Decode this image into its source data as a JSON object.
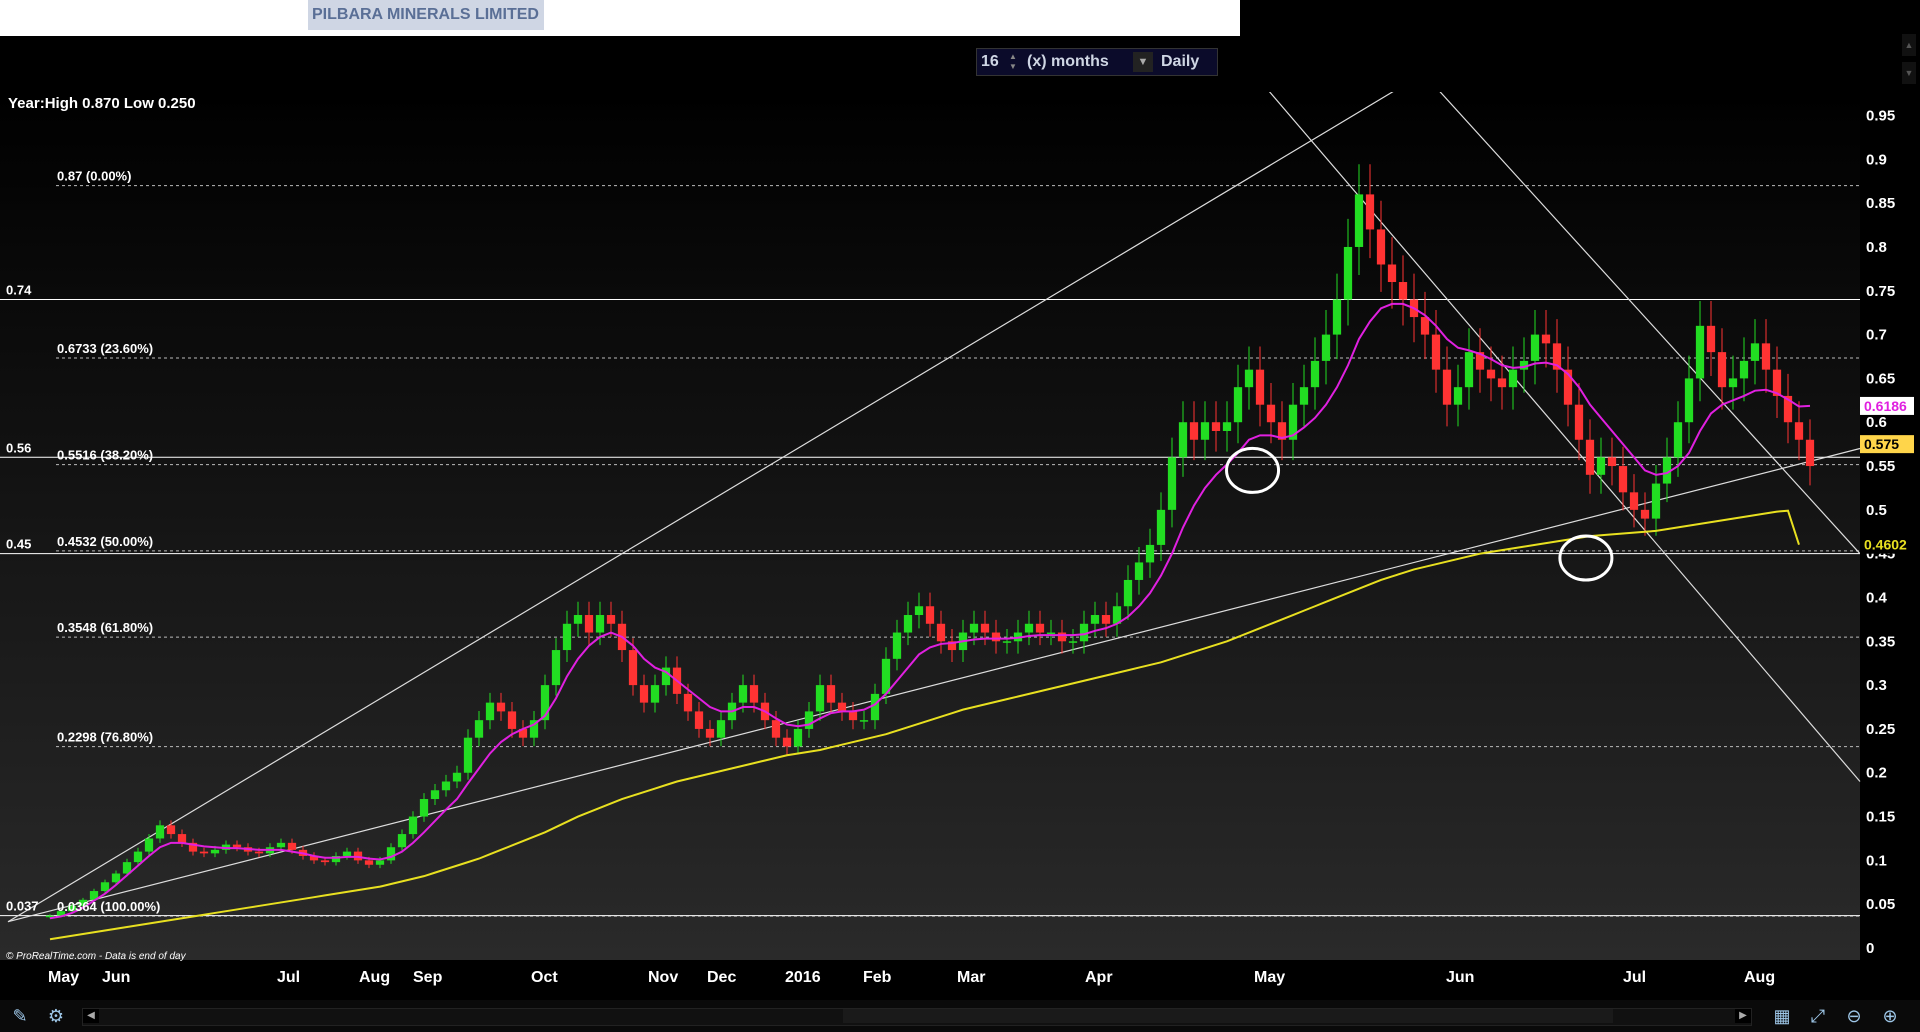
{
  "window": {
    "instrument_title": "PILBARA MINERALS LIMITED"
  },
  "toolbar": {
    "period_value": "16",
    "period_unit": "(x) months",
    "interval": "Daily"
  },
  "icons": {
    "spinner": "spinner-arrows-icon",
    "dropdown": "chevron-down-icon",
    "left": "scroll-left-icon",
    "right": "scroll-right-icon",
    "edit": "edit-chart-icon",
    "tools": "drawing-tools-icon",
    "settings": "chart-settings-icon",
    "zoom_fit": "zoom-fit-icon",
    "zoom_out": "zoom-out-icon",
    "zoom_in": "zoom-in-icon"
  },
  "colors": {
    "up": "#22dd22",
    "down": "#ff3333",
    "ma_short": "#e020e0",
    "ma_long": "#e8e020",
    "grid": "#ffffff",
    "axis_text": "#ffffff"
  },
  "chart_data": {
    "type": "candlestick",
    "title": "",
    "info_text": "Year:High 0.870 Low 0.250",
    "credit_text": "© ProRealTime.com - Data is end of day",
    "x_labels": [
      "May",
      "Jun",
      "Jul",
      "Aug",
      "Sep",
      "Oct",
      "Nov",
      "Dec",
      "2016",
      "Feb",
      "Mar",
      "Apr",
      "May",
      "Jun",
      "Jul",
      "Aug"
    ],
    "y_ticks": [
      "0.95",
      "0.9",
      "0.85",
      "0.8",
      "0.75",
      "0.7",
      "0.65",
      "0.6",
      "0.55",
      "0.5",
      "0.45",
      "0.4",
      "0.35",
      "0.3",
      "0.25",
      "0.2",
      "0.15",
      "0.1",
      "0.05",
      "0"
    ],
    "ylim": [
      0,
      0.97
    ],
    "price_tags": [
      {
        "text": "0.6186",
        "value": 0.6186,
        "bg": "#ffffff",
        "fg": "#e020e0"
      },
      {
        "text": "0.575",
        "value": 0.575,
        "bg": "#ffd54a",
        "fg": "#000000"
      },
      {
        "text": "0.4602",
        "value": 0.4602,
        "bg": "#000000",
        "fg": "#e8e020"
      }
    ],
    "fibonacci_levels": [
      {
        "label": "0.87 (0.00%)",
        "value": 0.87
      },
      {
        "label": "0.6733 (23.60%)",
        "value": 0.6733
      },
      {
        "label": "0.5516 (38.20%)",
        "value": 0.5516
      },
      {
        "label": "0.4532 (50.00%)",
        "value": 0.4532
      },
      {
        "label": "0.3548 (61.80%)",
        "value": 0.3548
      },
      {
        "label": "0.2298 (76.80%)",
        "value": 0.2298
      },
      {
        "label": "0.0364 (100.00%)",
        "value": 0.0364
      }
    ],
    "horizontal_lines": [
      {
        "label": "0.74",
        "value": 0.74
      },
      {
        "label": "0.56",
        "value": 0.56
      },
      {
        "label": "0.45",
        "value": 0.45
      },
      {
        "label": "0.037",
        "value": 0.037
      }
    ],
    "trendlines": [
      {
        "name": "upper-support",
        "from": [
          0.0,
          0.03
        ],
        "to": [
          0.75,
          0.98
        ]
      },
      {
        "name": "lower-support",
        "from": [
          0.0,
          0.03
        ],
        "to": [
          1.0,
          0.57
        ]
      },
      {
        "name": "downtrend-1",
        "from": [
          0.68,
          0.98
        ],
        "to": [
          1.0,
          0.19
        ]
      },
      {
        "name": "downtrend-2",
        "from": [
          0.772,
          0.98
        ],
        "to": [
          1.0,
          0.45
        ]
      }
    ],
    "markers": [
      {
        "name": "circle-support-1",
        "x": 0.672,
        "y": 0.545
      },
      {
        "name": "circle-support-2",
        "x": 0.852,
        "y": 0.445
      }
    ],
    "close_series": [
      0.037,
      0.042,
      0.048,
      0.055,
      0.065,
      0.075,
      0.085,
      0.098,
      0.11,
      0.125,
      0.14,
      0.13,
      0.12,
      0.11,
      0.108,
      0.112,
      0.118,
      0.115,
      0.11,
      0.108,
      0.115,
      0.12,
      0.112,
      0.105,
      0.1,
      0.098,
      0.105,
      0.11,
      0.1,
      0.095,
      0.1,
      0.115,
      0.13,
      0.15,
      0.17,
      0.18,
      0.19,
      0.2,
      0.24,
      0.26,
      0.28,
      0.27,
      0.25,
      0.24,
      0.26,
      0.3,
      0.34,
      0.37,
      0.38,
      0.36,
      0.38,
      0.37,
      0.34,
      0.3,
      0.28,
      0.3,
      0.32,
      0.29,
      0.27,
      0.25,
      0.24,
      0.26,
      0.28,
      0.3,
      0.28,
      0.26,
      0.24,
      0.23,
      0.25,
      0.27,
      0.3,
      0.28,
      0.27,
      0.26,
      0.26,
      0.29,
      0.33,
      0.36,
      0.38,
      0.39,
      0.37,
      0.35,
      0.34,
      0.36,
      0.37,
      0.36,
      0.35,
      0.35,
      0.36,
      0.37,
      0.36,
      0.36,
      0.35,
      0.35,
      0.37,
      0.38,
      0.37,
      0.39,
      0.42,
      0.44,
      0.46,
      0.5,
      0.56,
      0.6,
      0.58,
      0.6,
      0.59,
      0.6,
      0.64,
      0.66,
      0.62,
      0.6,
      0.58,
      0.62,
      0.64,
      0.67,
      0.7,
      0.74,
      0.8,
      0.86,
      0.82,
      0.78,
      0.76,
      0.74,
      0.72,
      0.7,
      0.66,
      0.62,
      0.64,
      0.68,
      0.66,
      0.65,
      0.64,
      0.66,
      0.67,
      0.7,
      0.69,
      0.66,
      0.62,
      0.58,
      0.54,
      0.56,
      0.55,
      0.52,
      0.5,
      0.49,
      0.53,
      0.56,
      0.6,
      0.65,
      0.71,
      0.68,
      0.64,
      0.65,
      0.67,
      0.69,
      0.66,
      0.63,
      0.6,
      0.58,
      0.55
    ],
    "ma_short_series": [
      0.034,
      0.036,
      0.04,
      0.046,
      0.054,
      0.062,
      0.072,
      0.083,
      0.094,
      0.105,
      0.115,
      0.12,
      0.12,
      0.118,
      0.116,
      0.115,
      0.114,
      0.114,
      0.113,
      0.112,
      0.112,
      0.112,
      0.11,
      0.108,
      0.105,
      0.103,
      0.103,
      0.104,
      0.104,
      0.102,
      0.101,
      0.104,
      0.11,
      0.12,
      0.132,
      0.145,
      0.158,
      0.17,
      0.188,
      0.205,
      0.222,
      0.235,
      0.244,
      0.25,
      0.255,
      0.265,
      0.285,
      0.31,
      0.33,
      0.345,
      0.355,
      0.36,
      0.355,
      0.345,
      0.33,
      0.32,
      0.315,
      0.305,
      0.295,
      0.285,
      0.275,
      0.27,
      0.27,
      0.275,
      0.275,
      0.27,
      0.262,
      0.255,
      0.253,
      0.255,
      0.262,
      0.268,
      0.27,
      0.27,
      0.272,
      0.278,
      0.29,
      0.305,
      0.32,
      0.335,
      0.343,
      0.347,
      0.348,
      0.35,
      0.352,
      0.353,
      0.353,
      0.353,
      0.354,
      0.356,
      0.357,
      0.357,
      0.357,
      0.357,
      0.358,
      0.362,
      0.365,
      0.37,
      0.378,
      0.39,
      0.405,
      0.425,
      0.45,
      0.48,
      0.505,
      0.525,
      0.54,
      0.552,
      0.565,
      0.58,
      0.585,
      0.585,
      0.582,
      0.585,
      0.594,
      0.605,
      0.62,
      0.64,
      0.665,
      0.695,
      0.715,
      0.73,
      0.735,
      0.735,
      0.73,
      0.722,
      0.71,
      0.695,
      0.685,
      0.682,
      0.678,
      0.672,
      0.665,
      0.662,
      0.663,
      0.667,
      0.668,
      0.665,
      0.655,
      0.64,
      0.62,
      0.605,
      0.59,
      0.575,
      0.56,
      0.545,
      0.54,
      0.542,
      0.55,
      0.565,
      0.59,
      0.61,
      0.62,
      0.625,
      0.63,
      0.636,
      0.637,
      0.633,
      0.626,
      0.618,
      0.6186
    ],
    "ma_long_series": [
      0.01,
      0.012,
      0.014,
      0.016,
      0.018,
      0.02,
      0.022,
      0.024,
      0.026,
      0.028,
      0.03,
      0.032,
      0.034,
      0.036,
      0.038,
      0.04,
      0.042,
      0.044,
      0.046,
      0.048,
      0.05,
      0.052,
      0.054,
      0.056,
      0.058,
      0.06,
      0.062,
      0.064,
      0.066,
      0.068,
      0.07,
      0.073,
      0.076,
      0.079,
      0.082,
      0.086,
      0.09,
      0.094,
      0.098,
      0.102,
      0.107,
      0.112,
      0.117,
      0.122,
      0.127,
      0.132,
      0.138,
      0.144,
      0.15,
      0.155,
      0.16,
      0.165,
      0.17,
      0.174,
      0.178,
      0.182,
      0.186,
      0.19,
      0.193,
      0.196,
      0.199,
      0.202,
      0.205,
      0.208,
      0.211,
      0.214,
      0.217,
      0.22,
      0.222,
      0.224,
      0.226,
      0.229,
      0.232,
      0.235,
      0.238,
      0.241,
      0.244,
      0.248,
      0.252,
      0.256,
      0.26,
      0.264,
      0.268,
      0.272,
      0.275,
      0.278,
      0.281,
      0.284,
      0.287,
      0.29,
      0.293,
      0.296,
      0.299,
      0.302,
      0.305,
      0.308,
      0.311,
      0.314,
      0.317,
      0.32,
      0.323,
      0.326,
      0.33,
      0.334,
      0.338,
      0.342,
      0.346,
      0.35,
      0.355,
      0.36,
      0.365,
      0.37,
      0.375,
      0.38,
      0.385,
      0.39,
      0.395,
      0.4,
      0.405,
      0.41,
      0.415,
      0.42,
      0.424,
      0.428,
      0.432,
      0.435,
      0.438,
      0.441,
      0.444,
      0.447,
      0.45,
      0.452,
      0.454,
      0.456,
      0.458,
      0.46,
      0.462,
      0.464,
      0.466,
      0.468,
      0.47,
      0.471,
      0.472,
      0.473,
      0.474,
      0.475,
      0.476,
      0.478,
      0.48,
      0.482,
      0.484,
      0.486,
      0.488,
      0.49,
      0.492,
      0.494,
      0.496,
      0.498,
      0.499,
      0.4602
    ]
  }
}
